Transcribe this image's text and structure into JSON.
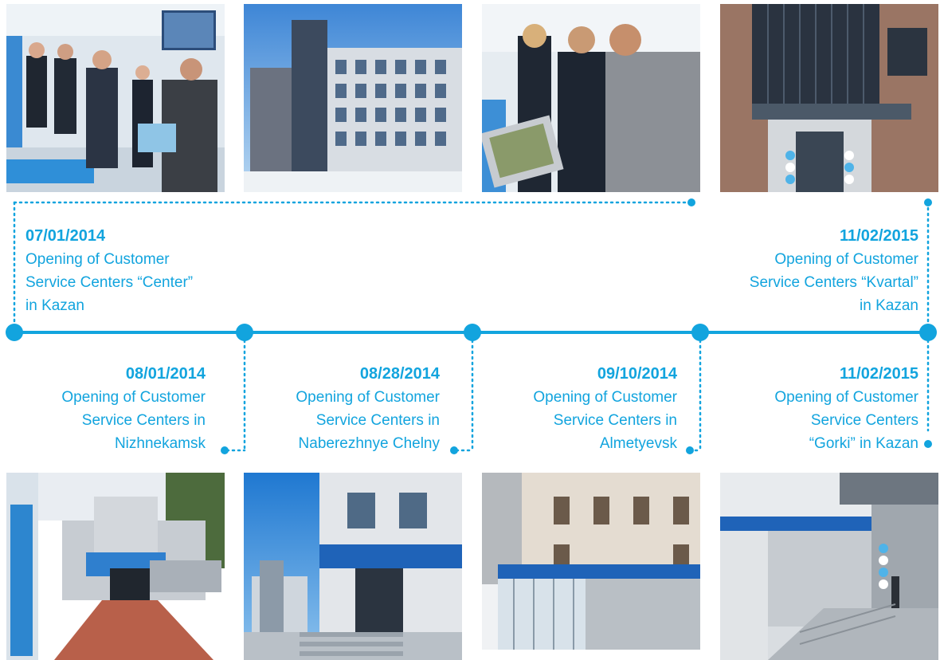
{
  "colors": {
    "accent": "#12a4de"
  },
  "events": [
    {
      "date": "07/01/2014",
      "lines": [
        "Opening of Customer",
        "Service Centers “Center”",
        "in Kazan"
      ]
    },
    {
      "date": "08/01/2014",
      "lines": [
        "Opening of Customer",
        "Service Centers in",
        "Nizhnekamsk"
      ]
    },
    {
      "date": "08/28/2014",
      "lines": [
        "Opening of Customer",
        "Service Centers in",
        "Naberezhnye Chelny"
      ]
    },
    {
      "date": "09/10/2014",
      "lines": [
        "Opening of Customer",
        "Service Centers in",
        "Almetyevsk"
      ]
    },
    {
      "date": "11/02/2015",
      "lines": [
        "Opening of Customer",
        "Service Centers “Kvartal”",
        "in Kazan"
      ]
    },
    {
      "date": "11/02/2015",
      "lines": [
        "Opening of Customer",
        "Service Centers",
        "“Gorki” in Kazan"
      ]
    }
  ],
  "photos": {
    "top": [
      "service-center-interior-meeting",
      "office-building-exterior",
      "terminal-demonstration",
      "kvartal-building-entrance"
    ],
    "bottom": [
      "nizhnekamsk-building",
      "naberezhnye-chelny-building",
      "almetyevsk-building",
      "gorki-building-entrance"
    ]
  }
}
